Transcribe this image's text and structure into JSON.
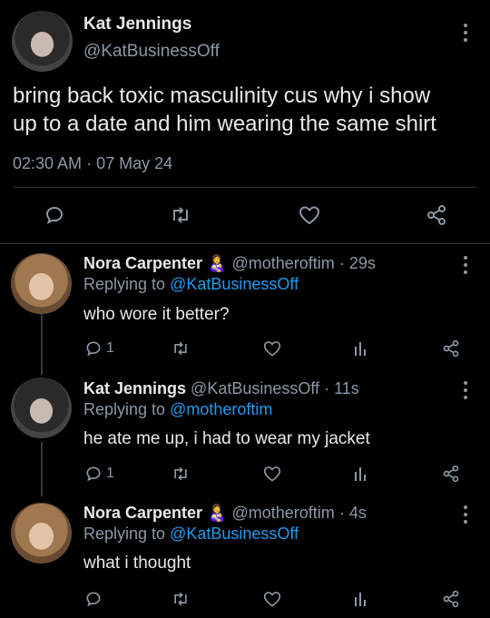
{
  "main_tweet": {
    "author_name": "Kat Jennings",
    "author_handle": "@KatBusinessOff",
    "text_line1": "bring back toxic masculinity cus why i show",
    "text_line2": "up to a date and him wearing the same shirt",
    "time": "02:30 AM",
    "sep": "·",
    "date": "07 May 24"
  },
  "replies": [
    {
      "author_name": "Nora Carpenter",
      "emoji": "👩‍🍼",
      "author_handle": "@motheroftim",
      "dot": "·",
      "age": "29s",
      "replying_prefix": "Replying to",
      "replying_to": "@KatBusinessOff",
      "text": "who wore it better?",
      "reply_count": "1"
    },
    {
      "author_name": "Kat Jennings",
      "author_handle": "@KatBusinessOff",
      "dot": "·",
      "age": "11s",
      "replying_prefix": "Replying to",
      "replying_to": "@motheroftim",
      "text": "he ate me up, i had to wear my jacket",
      "reply_count": "1"
    },
    {
      "author_name": "Nora Carpenter",
      "emoji": "👩‍🍼",
      "author_handle": "@motheroftim",
      "dot": "·",
      "age": "4s",
      "replying_prefix": "Replying to",
      "replying_to": "@KatBusinessOff",
      "text": "what i thought"
    }
  ],
  "colors": {
    "background": "#000000",
    "text": "#e7e9ea",
    "muted": "#8b98a5",
    "link": "#1d9bf0"
  }
}
